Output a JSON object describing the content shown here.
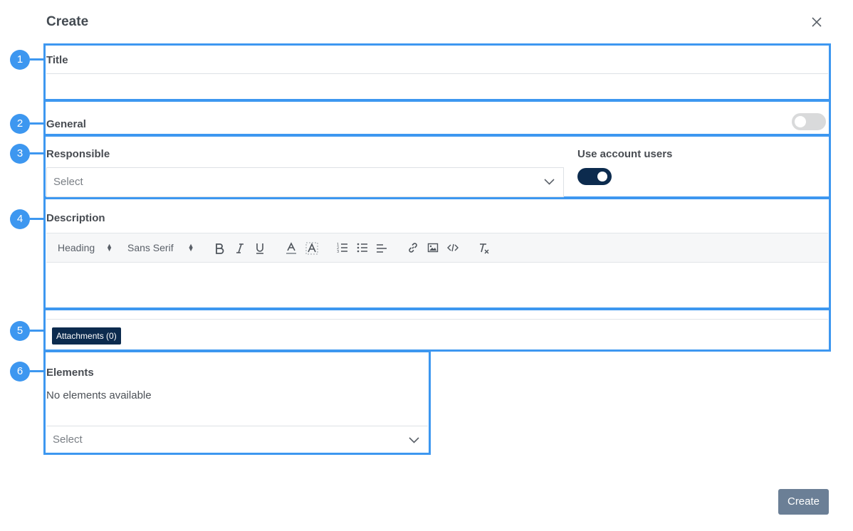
{
  "dialog": {
    "title": "Create",
    "close_icon": "close-icon"
  },
  "markers": [
    "1",
    "2",
    "3",
    "4",
    "5",
    "6"
  ],
  "title_field": {
    "label": "Title",
    "value": ""
  },
  "general": {
    "label": "General",
    "toggle_on": false
  },
  "responsible": {
    "label": "Responsible",
    "placeholder": "Select"
  },
  "account_users": {
    "label": "Use account users",
    "toggle_on": true
  },
  "description": {
    "label": "Description",
    "toolbar": {
      "heading": "Heading",
      "font": "Sans Serif",
      "icons": [
        "bold-icon",
        "italic-icon",
        "underline-icon",
        "text-color-icon",
        "background-color-icon",
        "ordered-list-icon",
        "bullet-list-icon",
        "align-icon",
        "link-icon",
        "image-icon",
        "code-icon",
        "clear-format-icon"
      ]
    },
    "value": ""
  },
  "attachments": {
    "label": "Attachments (0)"
  },
  "elements": {
    "label": "Elements",
    "empty_text": "No elements available",
    "placeholder": "Select"
  },
  "footer": {
    "create_label": "Create"
  },
  "colors": {
    "highlight": "#3d97f0",
    "primary_dark": "#0c2b4e",
    "button": "#6b7f96"
  }
}
